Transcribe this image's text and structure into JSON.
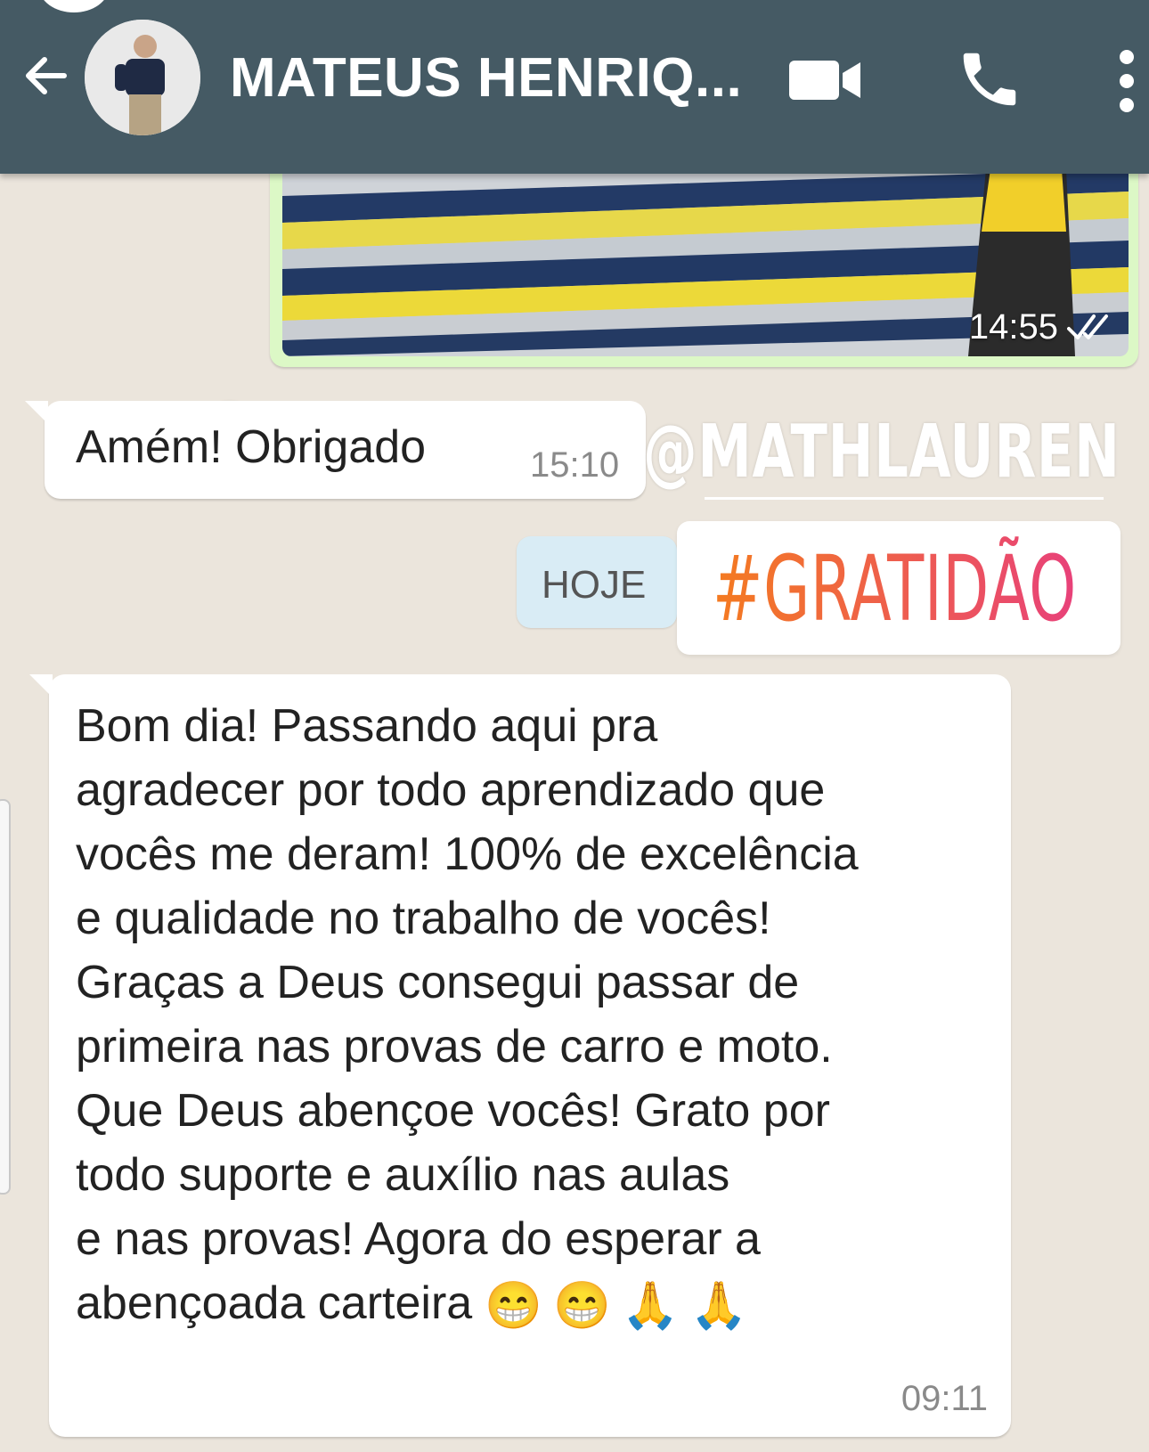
{
  "header": {
    "contact_name": "MATEUS HENRIQ...",
    "icons": [
      "back-arrow-icon",
      "video-call-icon",
      "phone-icon",
      "more-vertical-icon"
    ],
    "background_color": "#455a64"
  },
  "messages": {
    "image_message": {
      "time": "14:55",
      "status_icon": "double-check-icon"
    },
    "message_1": {
      "text": "Amém! Obrigado",
      "time": "15:10"
    },
    "date_separator": "HOJE",
    "message_2": {
      "text": "Bom dia! Passando aqui pra\nagradecer por todo aprendizado que\nvocês me deram! 100% de excelência\ne qualidade no trabalho de vocês!\nGraças a Deus consegui passar de\nprimeira nas provas de carro e moto.\nQue Deus abençoe vocês! Grato por\ntodo suporte e auxílio nas aulas\ne nas provas! Agora do esperar a\nabençoada carteira",
      "emojis": [
        "😁",
        "😁",
        "🙏",
        "🙏"
      ],
      "time": "09:11"
    }
  },
  "overlay": {
    "mention": "@MATHLAUREN",
    "hashtag": "#GRATIDÃO",
    "hashtag_gradient": [
      "#f47b20",
      "#e8417a"
    ]
  },
  "colors": {
    "outgoing_bubble": "#dcf8c6",
    "incoming_bubble": "#ffffff",
    "chat_background": "#ebe5dc",
    "date_chip": "#d9ecf5"
  }
}
